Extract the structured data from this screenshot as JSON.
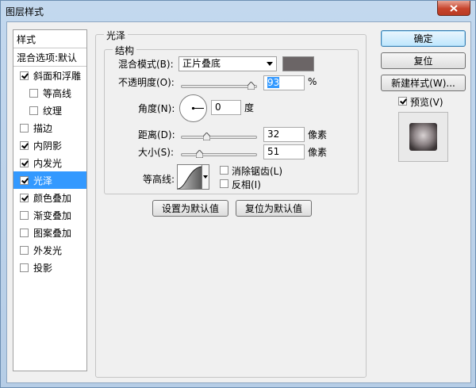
{
  "window": {
    "title": "图层样式"
  },
  "style_list": {
    "header": "样式",
    "blend_options": "混合选项:默认",
    "items": [
      {
        "label": "斜面和浮雕",
        "checked": true,
        "sub": false,
        "selected": false
      },
      {
        "label": "等高线",
        "checked": false,
        "sub": true,
        "selected": false
      },
      {
        "label": "纹理",
        "checked": false,
        "sub": true,
        "selected": false
      },
      {
        "label": "描边",
        "checked": false,
        "sub": false,
        "selected": false
      },
      {
        "label": "内阴影",
        "checked": true,
        "sub": false,
        "selected": false
      },
      {
        "label": "内发光",
        "checked": true,
        "sub": false,
        "selected": false
      },
      {
        "label": "光泽",
        "checked": true,
        "sub": false,
        "selected": true
      },
      {
        "label": "颜色叠加",
        "checked": true,
        "sub": false,
        "selected": false
      },
      {
        "label": "渐变叠加",
        "checked": false,
        "sub": false,
        "selected": false
      },
      {
        "label": "图案叠加",
        "checked": false,
        "sub": false,
        "selected": false
      },
      {
        "label": "外发光",
        "checked": false,
        "sub": false,
        "selected": false
      },
      {
        "label": "投影",
        "checked": false,
        "sub": false,
        "selected": false
      }
    ]
  },
  "satin": {
    "group_title": "光泽",
    "structure_title": "结构",
    "blend_mode_label": "混合模式(B):",
    "blend_mode_value": "正片叠底",
    "color": "#6b6566",
    "opacity_label": "不透明度(O):",
    "opacity_value": "93",
    "opacity_unit": "%",
    "angle_label": "角度(N):",
    "angle_value": "0",
    "angle_unit": "度",
    "distance_label": "距离(D):",
    "distance_value": "32",
    "distance_unit": "像素",
    "size_label": "大小(S):",
    "size_value": "51",
    "size_unit": "像素",
    "contour_label": "等高线:",
    "antialias_label": "消除锯齿(L)",
    "invert_label": "反相(I)",
    "antialias_checked": false,
    "invert_checked": false,
    "make_default": "设置为默认值",
    "reset_default": "复位为默认值"
  },
  "buttons": {
    "ok": "确定",
    "reset": "复位",
    "new_style": "新建样式(W)...",
    "preview_label": "预览(V)",
    "preview_checked": true
  }
}
